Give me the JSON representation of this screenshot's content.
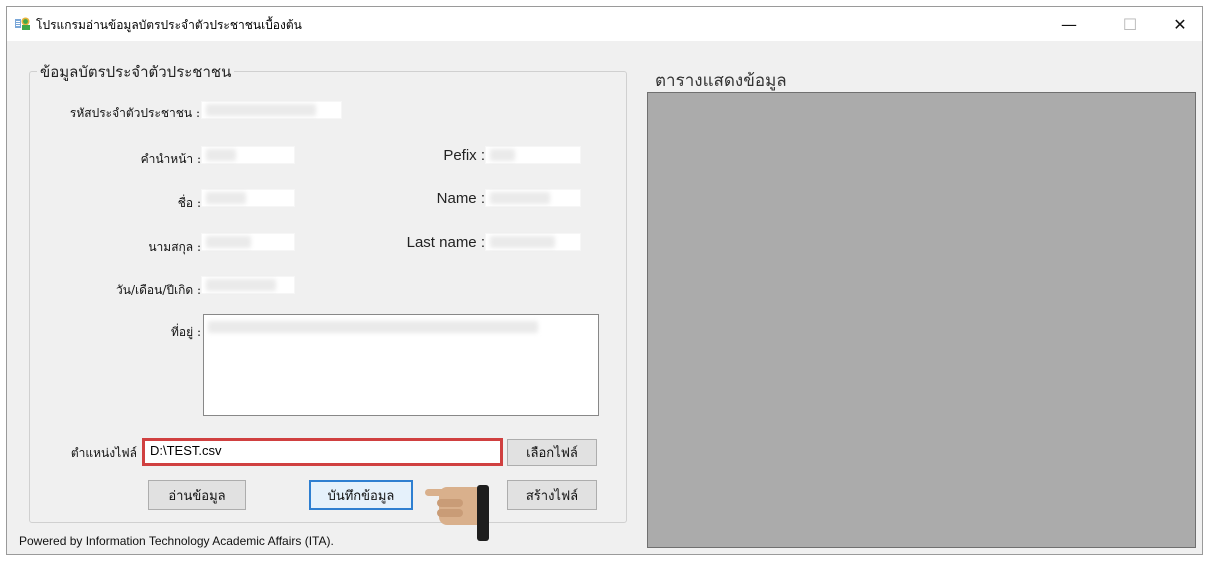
{
  "window": {
    "title": "โปรแกรมอ่านข้อมูลบัตรประจำตัวประชาชนเบื้องต้น",
    "controls": {
      "minimize": "—",
      "maximize": "☐",
      "close": "✕"
    }
  },
  "card_group": {
    "title": "ข้อมูลบัตรประจำตัวประชาชน",
    "labels": {
      "id_number": "รหัสประจำตัวประชาชน :",
      "prefix_th": "คำนำหน้า :",
      "prefix_en": "Pefix :",
      "first_name_th": "ชื่อ :",
      "first_name_en": "Name :",
      "last_name_th": "นามสกุล :",
      "last_name_en": "Last name :",
      "birth_date": "วัน/เดือน/ปีเกิด :",
      "address": "ที่อยู่ :"
    },
    "file_path_label": "ตำแหน่งไฟล์",
    "file_path_value": "D:\\TEST.csv",
    "buttons": {
      "browse": "เลือกไฟล์",
      "read": "อ่านข้อมูล",
      "save": "บันทึกข้อมูล",
      "create": "สร้างไฟล์"
    }
  },
  "table_panel": {
    "title": "ตารางแสดงข้อมูล"
  },
  "footer": "Powered by Information Technology Academic Affairs (ITA).",
  "colors": {
    "highlight_border": "#d04040",
    "focus_border": "#2e7fd1",
    "grid_background": "#ababab"
  },
  "icons": {
    "app": "app-icon",
    "pointer": "hand-pointer-icon"
  }
}
